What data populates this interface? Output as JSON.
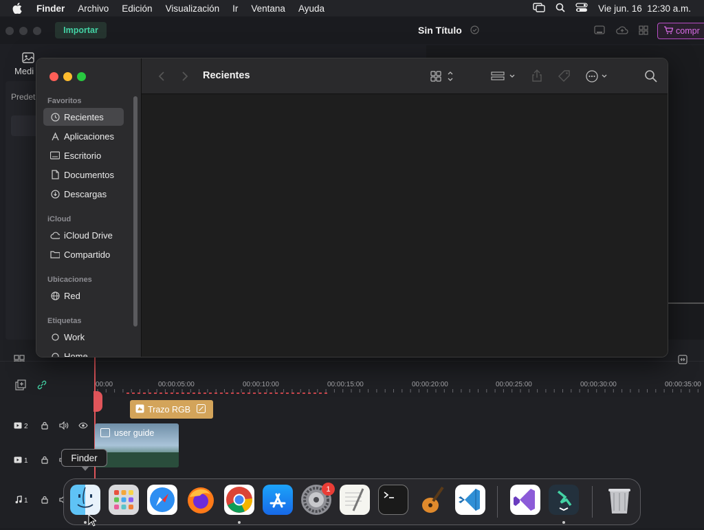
{
  "menubar": {
    "items": [
      "Finder",
      "Archivo",
      "Edición",
      "Visualización",
      "Ir",
      "Ventana",
      "Ayuda"
    ],
    "clock": "Vie jun. 16  12:30 a.m."
  },
  "app": {
    "import_label": "Importar",
    "project_title": "Sin Título",
    "buy_label": "compr",
    "media_tab_label": "Medi",
    "left_panel_label": "Predet",
    "accent_color": "#43d2a4",
    "buy_color": "#d96ce7"
  },
  "timeline": {
    "ticks": [
      "00:00",
      "00:00:05:00",
      "00:00:10:00",
      "00:00:15:00",
      "00:00:20:00",
      "00:00:25:00",
      "00:00:30:00",
      "00:00:35:00"
    ],
    "tracks": [
      {
        "num": "2",
        "type": "video"
      },
      {
        "num": "1",
        "type": "video"
      },
      {
        "num": "1",
        "type": "audio"
      }
    ],
    "fx_clip_label": "Trazo RGB",
    "video_clip_label": "user guide",
    "playhead_color": "#e0555a"
  },
  "finder": {
    "title": "Recientes",
    "sections": [
      {
        "heading": "Favoritos",
        "items": [
          {
            "label": "Recientes",
            "icon": "clock-icon",
            "selected": true
          },
          {
            "label": "Aplicaciones",
            "icon": "apps-icon"
          },
          {
            "label": "Escritorio",
            "icon": "desktop-icon"
          },
          {
            "label": "Documentos",
            "icon": "document-icon"
          },
          {
            "label": "Descargas",
            "icon": "download-icon"
          }
        ]
      },
      {
        "heading": "iCloud",
        "items": [
          {
            "label": "iCloud Drive",
            "icon": "cloud-icon"
          },
          {
            "label": "Compartido",
            "icon": "shared-folder-icon"
          }
        ]
      },
      {
        "heading": "Ubicaciones",
        "items": [
          {
            "label": "Red",
            "icon": "globe-icon"
          }
        ]
      },
      {
        "heading": "Etiquetas",
        "items": [
          {
            "label": "Work",
            "icon": "tag-circle-icon"
          },
          {
            "label": "Home",
            "icon": "tag-circle-icon"
          }
        ]
      }
    ]
  },
  "dock": {
    "tooltip": "Finder",
    "badge_count": "1",
    "apps": [
      "finder",
      "launchpad",
      "safari",
      "firefox",
      "chrome",
      "app-store",
      "system-settings",
      "textedit",
      "terminal",
      "garageband",
      "vscode",
      "visual-studio",
      "filmora",
      "trash"
    ]
  }
}
